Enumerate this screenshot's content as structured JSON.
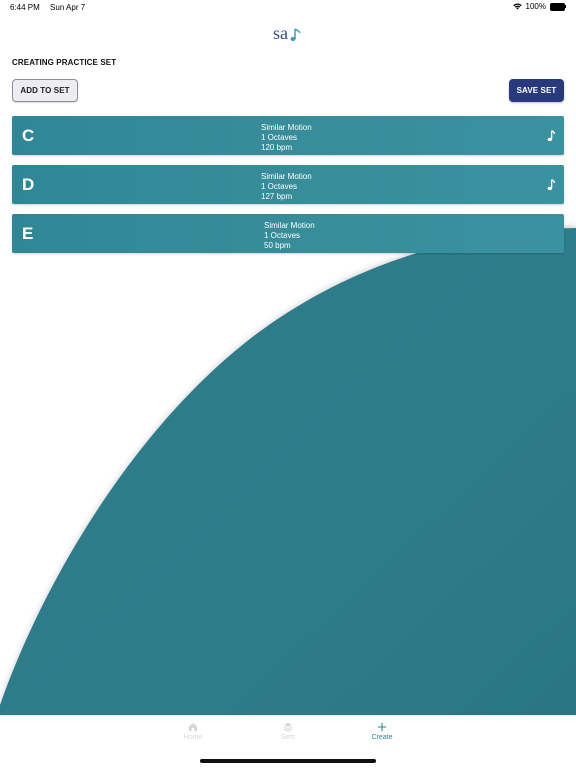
{
  "status_bar": {
    "time": "6:44 PM",
    "date": "Sun Apr 7",
    "battery_percent": "100%"
  },
  "app": {
    "logo_text": "sa",
    "page_title": "CREATING PRACTICE SET"
  },
  "toolbar": {
    "add_label": "ADD TO SET",
    "save_label": "SAVE SET"
  },
  "practice_items": [
    {
      "letter": "C",
      "motion": "Similar Motion",
      "octaves": "1 Octaves",
      "bpm": "120 bpm",
      "has_music_icon": true
    },
    {
      "letter": "D",
      "motion": "Similar Motion",
      "octaves": "1 Octaves",
      "bpm": "127 bpm",
      "has_music_icon": true
    },
    {
      "letter": "E",
      "motion": "Similar Motion",
      "octaves": "1 Octaves",
      "bpm": "50 bpm",
      "has_music_icon": false
    }
  ],
  "tab_bar": {
    "tabs": [
      {
        "label": "Home",
        "icon": "home-icon",
        "active": false
      },
      {
        "label": "Sets",
        "icon": "sets-icon",
        "active": false
      },
      {
        "label": "Create",
        "icon": "plus-icon",
        "active": true
      }
    ]
  },
  "colors": {
    "accent": "#2f8694",
    "save_button": "#29397e",
    "background_wave": "#2d7b89"
  }
}
